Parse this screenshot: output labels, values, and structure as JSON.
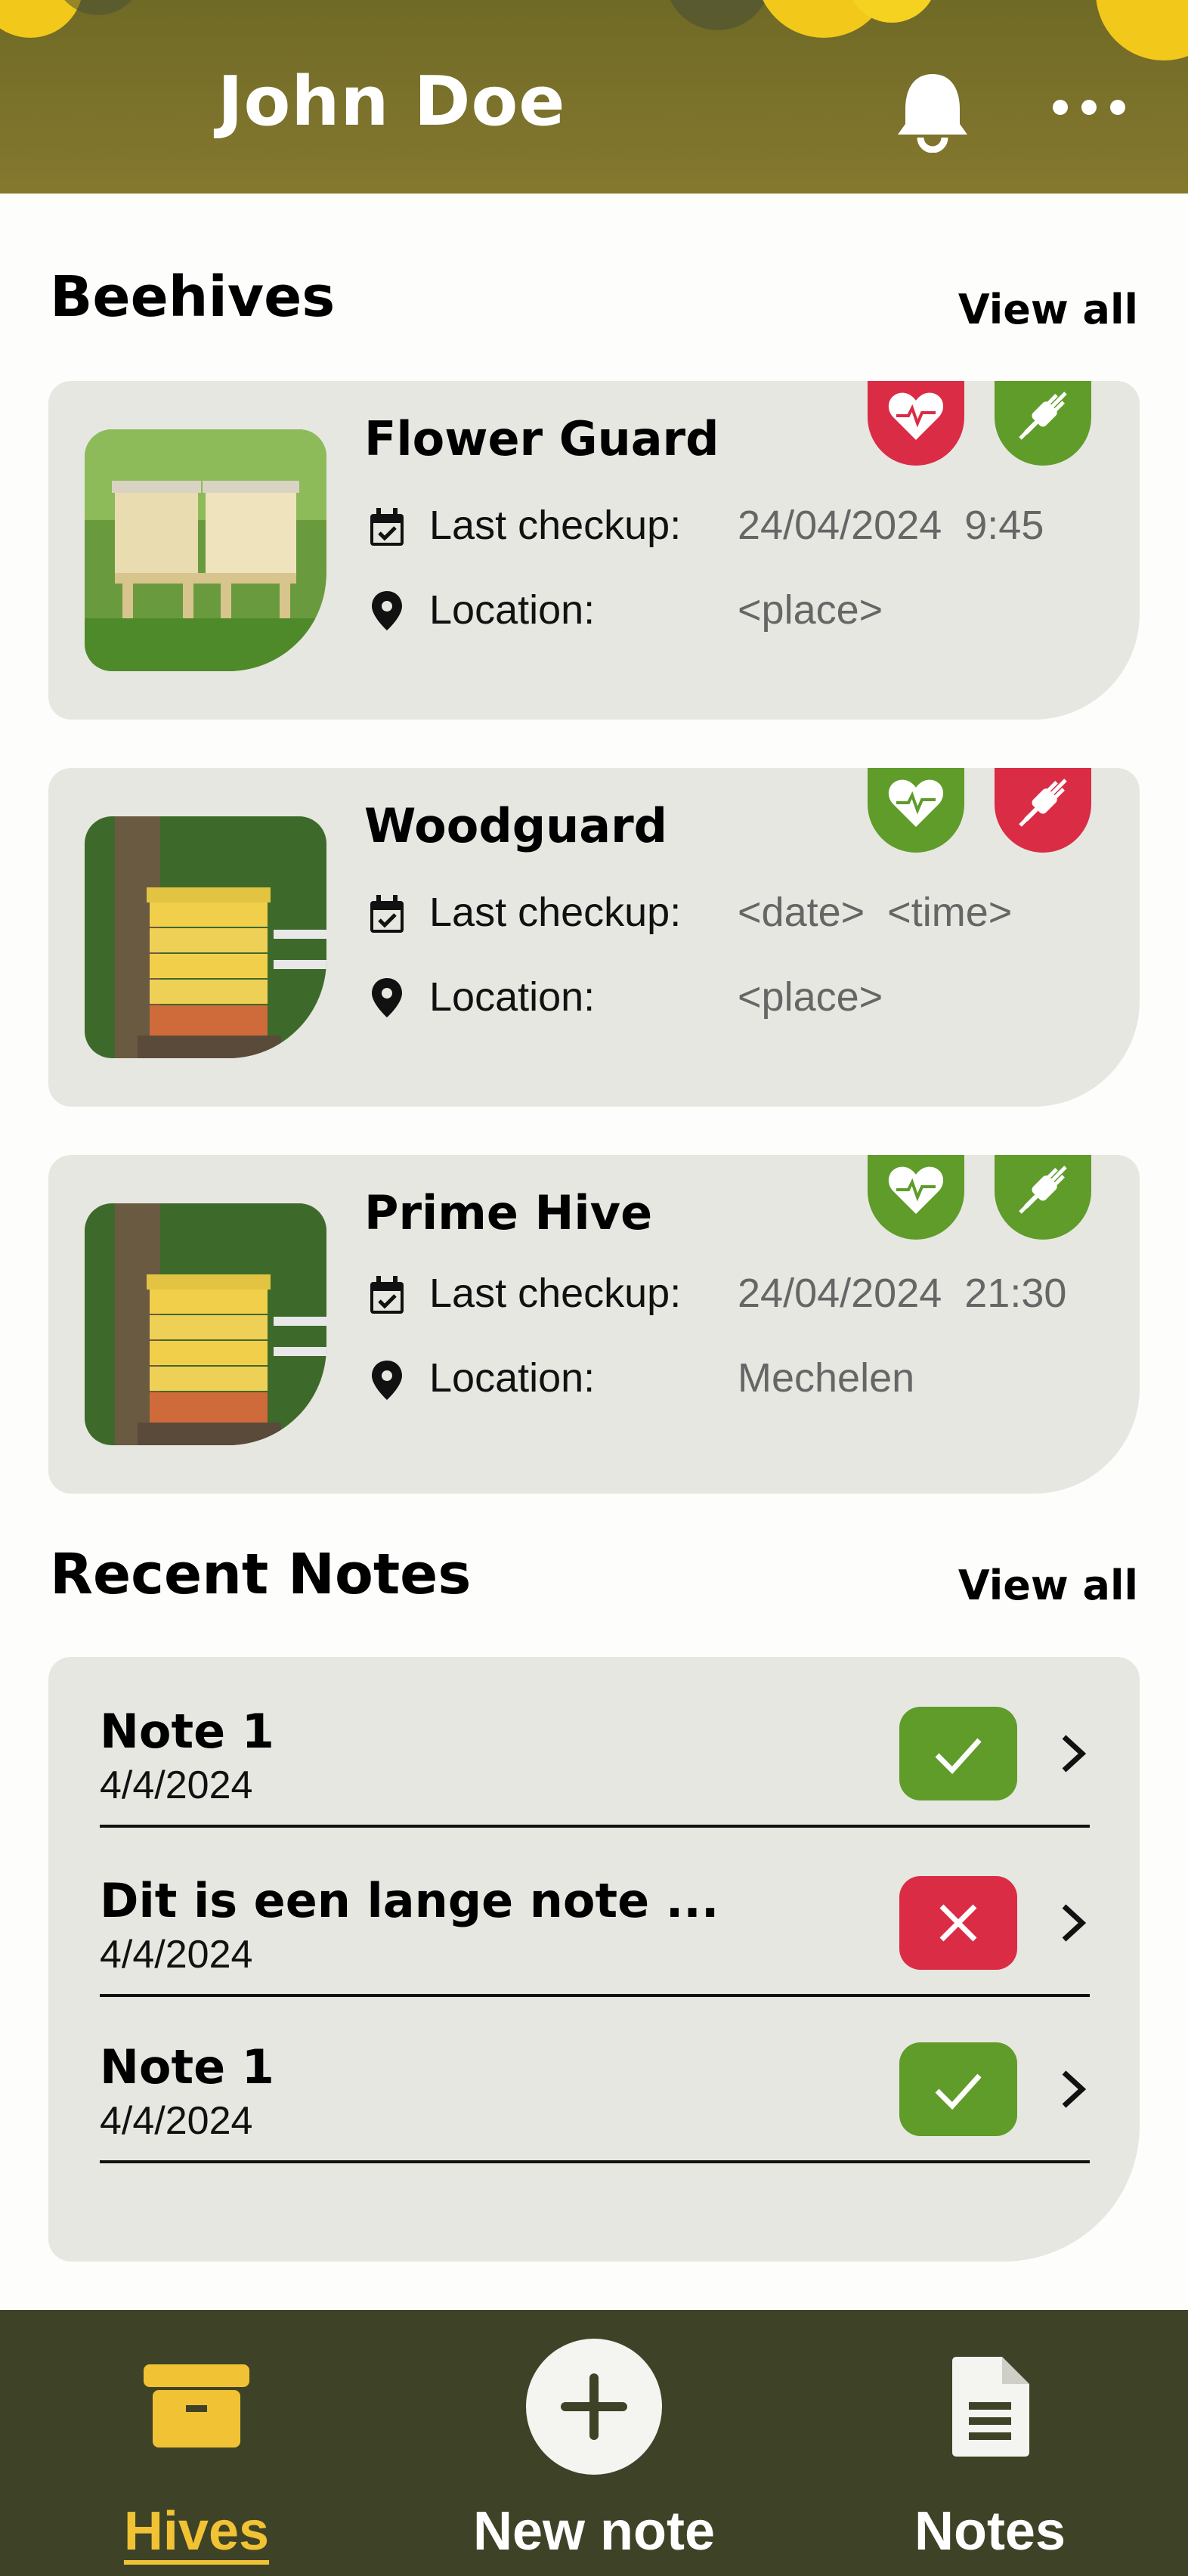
{
  "header": {
    "user_name": "John Doe",
    "icons": [
      "bell-icon",
      "more-icon"
    ]
  },
  "beehives": {
    "title": "Beehives",
    "view_all": "View all",
    "items": [
      {
        "name": "Flower Guard",
        "checkup_label": "Last checkup:",
        "checkup_value": "24/04/2024  9:45",
        "location_label": "Location:",
        "location_value": "<place>",
        "health_status": "bad",
        "connection_status": "good"
      },
      {
        "name": "Woodguard",
        "checkup_label": "Last checkup:",
        "checkup_value": "<date>  <time>",
        "location_label": "Location:",
        "location_value": "<place>",
        "health_status": "good",
        "connection_status": "bad"
      },
      {
        "name": "Prime Hive",
        "checkup_label": "Last checkup:",
        "checkup_value": "24/04/2024  21:30",
        "location_label": "Location:",
        "location_value": "Mechelen",
        "health_status": "good",
        "connection_status": "good"
      }
    ]
  },
  "recent_notes": {
    "title": "Recent Notes",
    "view_all": "View all",
    "items": [
      {
        "title": "Note 1",
        "date": "4/4/2024",
        "status": "done"
      },
      {
        "title": "Dit is een lange note ...",
        "date": "4/4/2024",
        "status": "failed"
      },
      {
        "title": "Note 1",
        "date": "4/4/2024",
        "status": "done"
      }
    ]
  },
  "nav": {
    "hives": "Hives",
    "new_note": "New note",
    "notes": "Notes",
    "active": "hives"
  },
  "colors": {
    "header": "#7a7230",
    "card": "#e7e7e1",
    "red": "#db2c45",
    "green": "#5f9c2a",
    "nav": "#3e4327",
    "accent": "#f1c233"
  }
}
